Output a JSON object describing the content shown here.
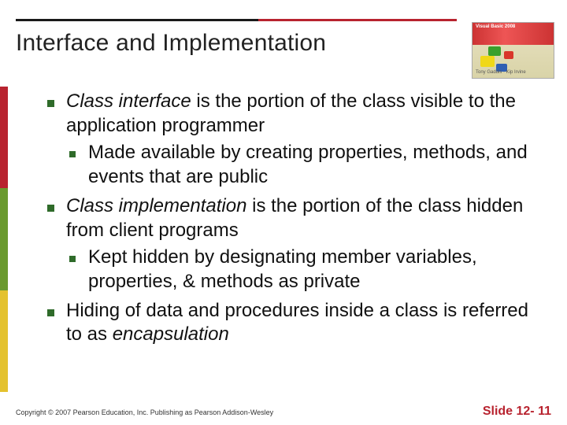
{
  "header": {
    "title": "Interface and Implementation",
    "cover_top_label": "Visual Basic 2008",
    "cover_bottom_label": "Tony Gaddis · Kip Irvine"
  },
  "bullets": [
    {
      "lead_prefix": "Class interface",
      "lead_suffix": " is the portion of the class visible to the application programmer",
      "sub": "Made available by creating properties, methods, and events that are public"
    },
    {
      "lead_prefix": "Class implementation",
      "lead_suffix": " is the portion of the class hidden from client programs",
      "sub": "Kept hidden by designating member variables, properties, & methods as private"
    },
    {
      "lead": "Hiding of data and procedures inside a class is referred to as ",
      "lead_emph": "encapsulation"
    }
  ],
  "footer": {
    "copyright": "Copyright © 2007 Pearson Education, Inc. Publishing as Pearson Addison-Wesley",
    "slide_number": "Slide 12- 11"
  }
}
